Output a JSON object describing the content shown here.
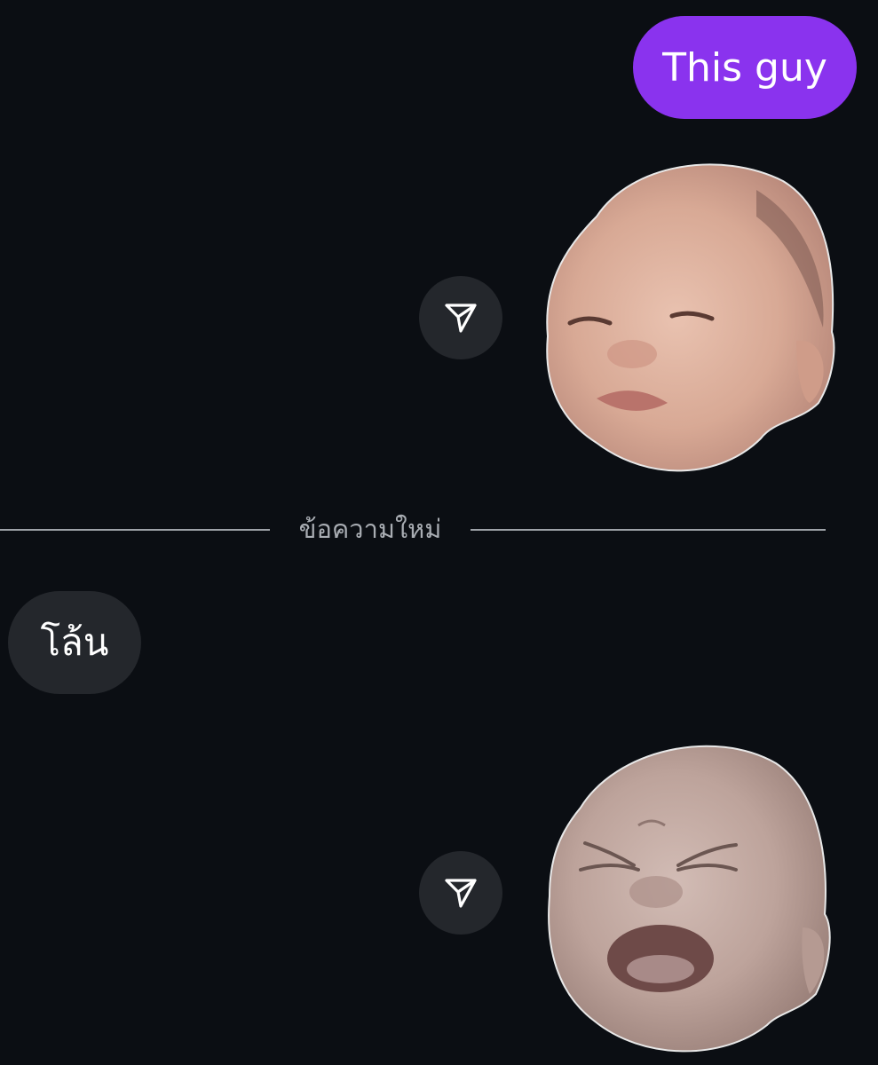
{
  "chat": {
    "messages": [
      {
        "direction": "sent",
        "type": "text",
        "text": "This guy"
      },
      {
        "direction": "sent",
        "type": "sticker",
        "sticker_name": "baby-face-smile-sticker",
        "action_icon": "share-send-icon"
      },
      {
        "direction": "received",
        "type": "text",
        "text": "โล้น"
      },
      {
        "direction": "sent",
        "type": "sticker",
        "sticker_name": "baby-face-crying-sticker",
        "action_icon": "share-send-icon"
      }
    ],
    "new_messages_divider": "ข้อความใหม่"
  },
  "colors": {
    "background": "#0b0e13",
    "sent_bubble": "#8a33ee",
    "received_bubble": "#24272c",
    "divider_line": "#9ea2a8",
    "divider_text": "#a9adb3",
    "share_button": "#24272c",
    "text": "#ffffff"
  }
}
